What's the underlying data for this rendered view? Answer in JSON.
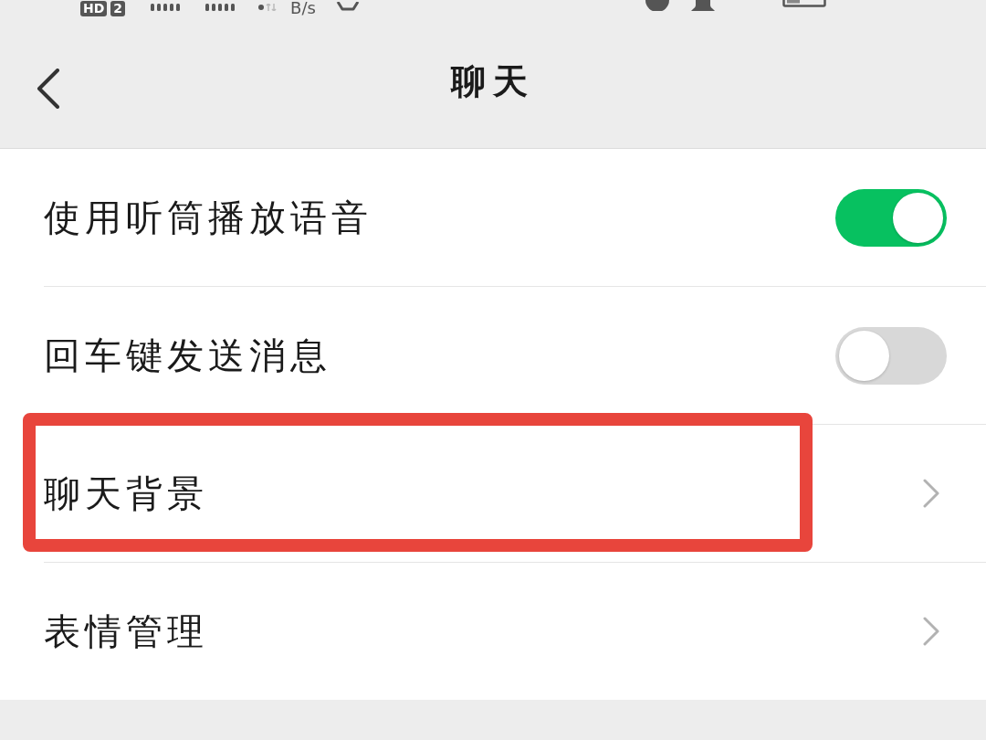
{
  "status_bar": {
    "badges": [
      "HD",
      "2"
    ],
    "speed": "B/s"
  },
  "nav": {
    "title": "聊天"
  },
  "rows": [
    {
      "kind": "toggle",
      "label": "使用听筒播放语音",
      "on": true,
      "highlighted": false
    },
    {
      "kind": "toggle",
      "label": "回车键发送消息",
      "on": false,
      "highlighted": false
    },
    {
      "kind": "link",
      "label": "聊天背景",
      "highlighted": true
    },
    {
      "kind": "link",
      "label": "表情管理",
      "highlighted": false
    }
  ]
}
